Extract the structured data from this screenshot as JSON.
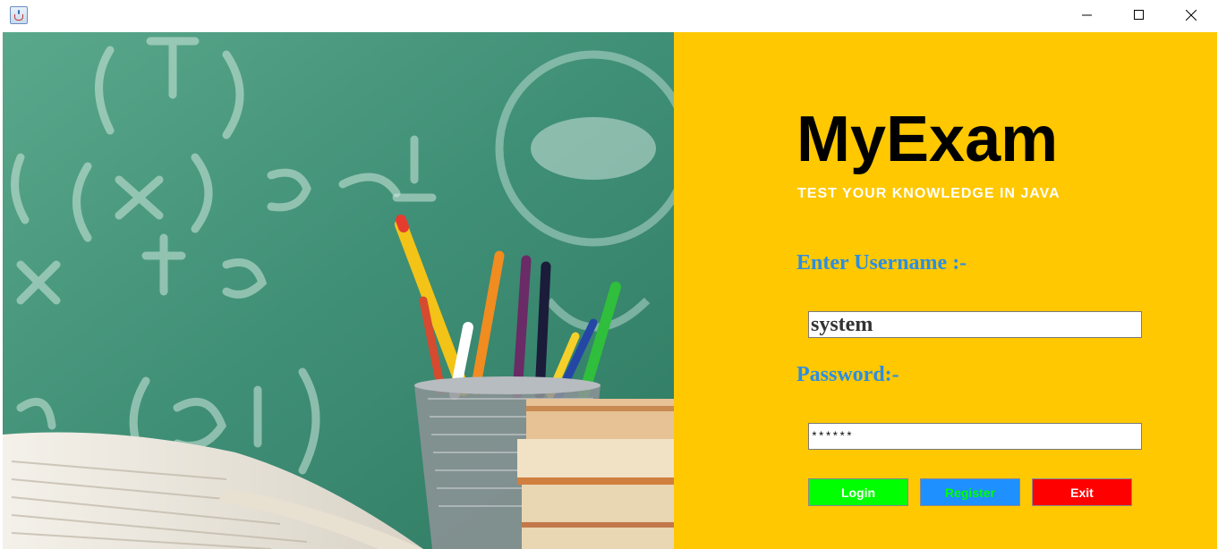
{
  "window": {
    "icon": "java-cup-icon",
    "controls": [
      "minimize-icon",
      "maximize-icon",
      "close-icon"
    ]
  },
  "hero": {
    "image": "classroom-chalkboard-pencils-books-illustration"
  },
  "brand": {
    "title": "MyExam",
    "subtitle": "TEST YOUR KNOWLEDGE IN JAVA"
  },
  "form": {
    "username_label": "Enter Username :-",
    "username_value": "system",
    "password_label": "Password:-",
    "password_value": "******"
  },
  "buttons": {
    "login": "Login",
    "register": "Register",
    "exit": "Exit"
  },
  "colors": {
    "panel_bg": "#ffc800",
    "label_blue": "#2b8de3",
    "login_bg": "#00ff00",
    "register_bg": "#1e90ff",
    "register_text": "#00ff00",
    "exit_bg": "#ff0000"
  }
}
